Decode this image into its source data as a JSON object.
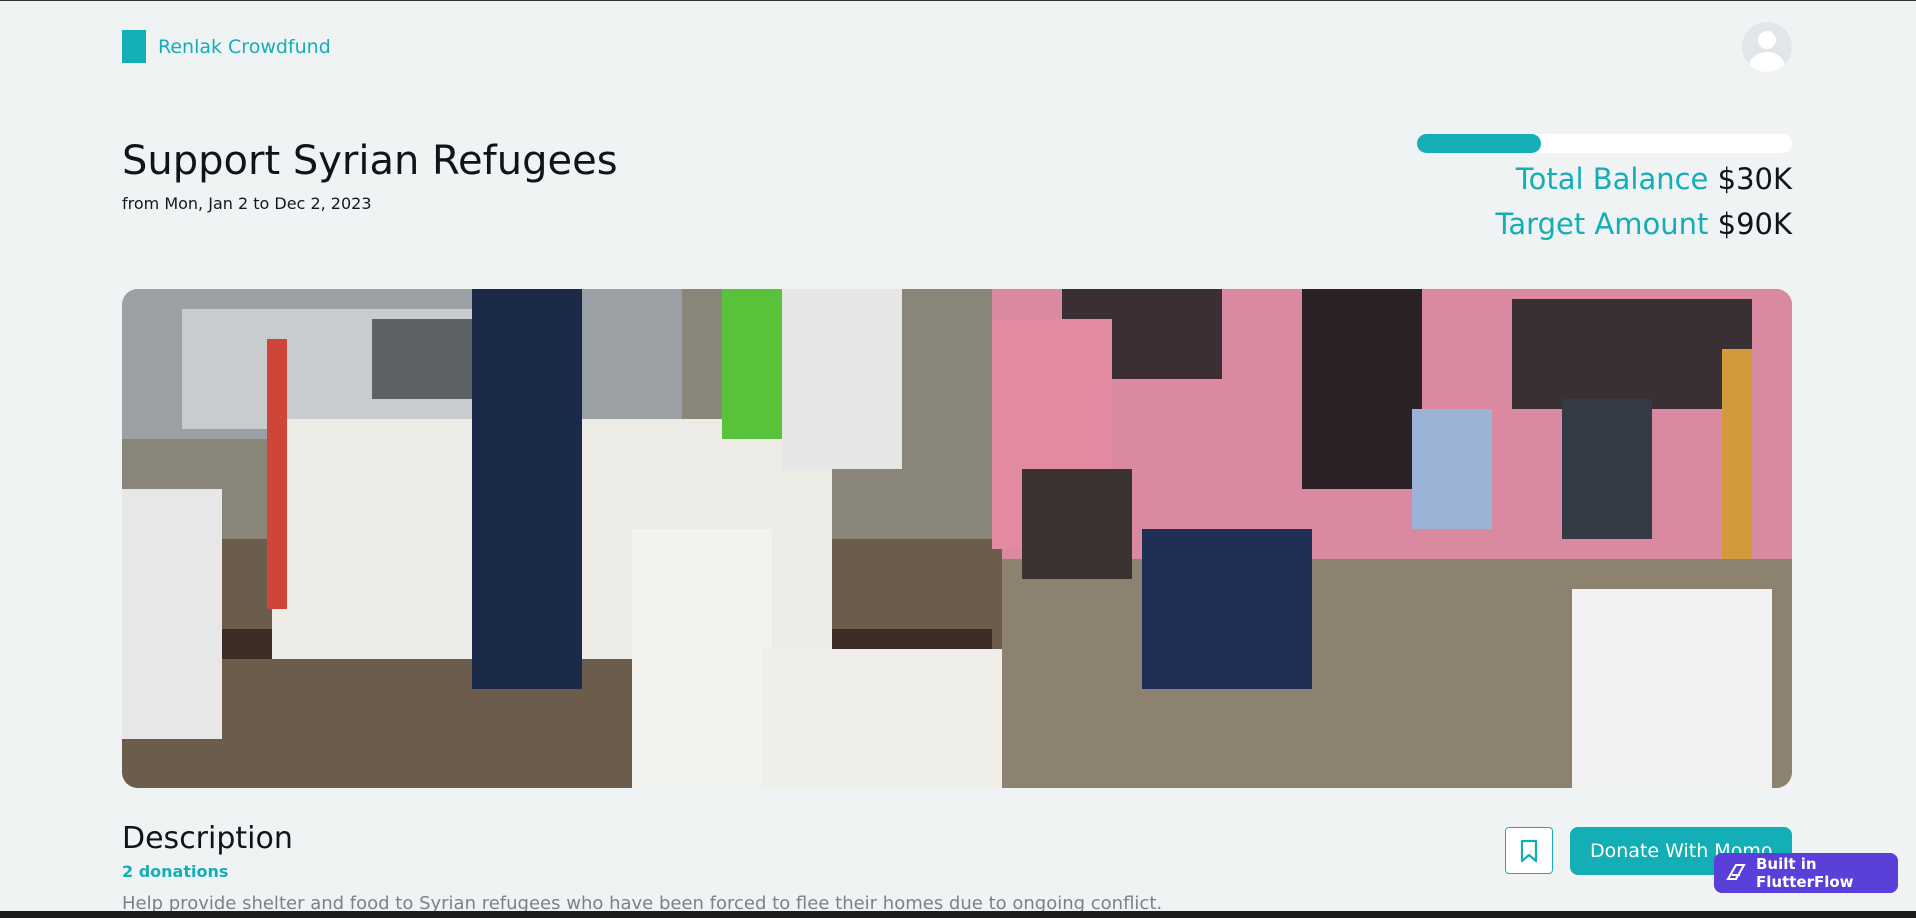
{
  "header": {
    "brand": "Renlak Crowdfund"
  },
  "campaign": {
    "title": "Support Syrian Refugees",
    "date_range": "from Mon, Jan 2 to Dec 2, 2023",
    "progress_fraction": 0.33,
    "total_balance_label": "Total Balance",
    "total_balance_value": "$30K",
    "target_amount_label": "Target Amount",
    "target_amount_value": "$90K"
  },
  "description": {
    "heading": "Description",
    "donations": "2 donations",
    "text": "Help provide shelter and food to Syrian refugees who have been forced to flee their homes due to ongoing conflict."
  },
  "actions": {
    "donate_label": "Donate With Momo"
  },
  "badge": {
    "label": "Built in FlutterFlow"
  },
  "colors": {
    "accent": "#14aeb7",
    "badge": "#5b3fd9",
    "background": "#f0f3f4"
  },
  "icons": {
    "bookmark": "bookmark-icon",
    "avatar": "user-avatar-icon",
    "flutterflow": "flutterflow-logo-icon"
  }
}
